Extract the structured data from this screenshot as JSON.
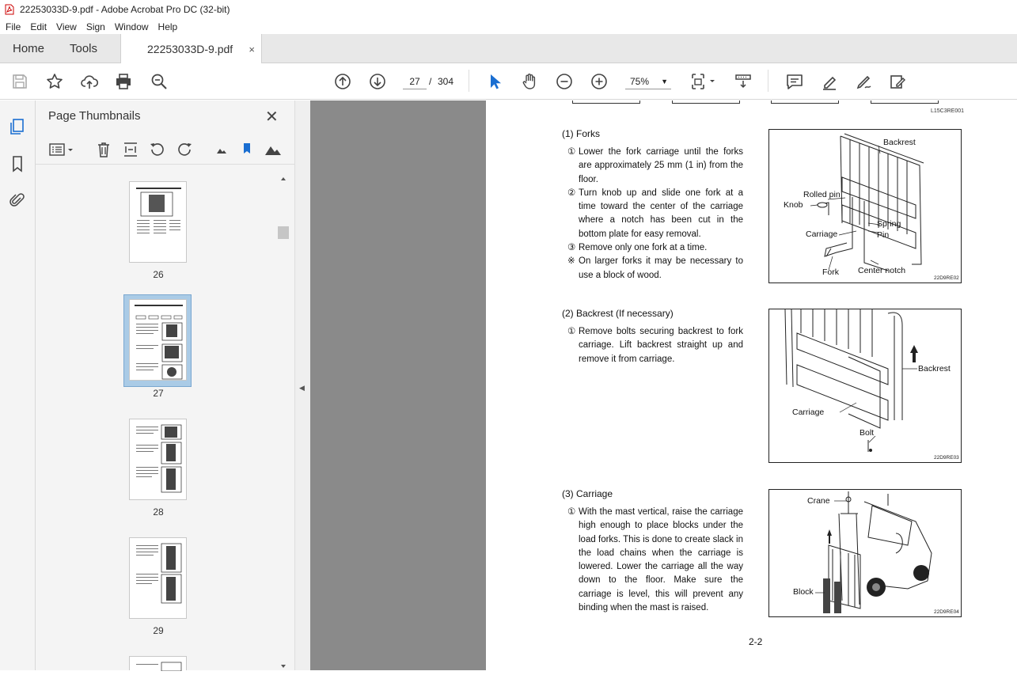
{
  "window": {
    "title": "22253033D-9.pdf - Adobe Acrobat Pro DC (32-bit)"
  },
  "menu": [
    "File",
    "Edit",
    "View",
    "Sign",
    "Window",
    "Help"
  ],
  "tabs": {
    "home": "Home",
    "tools": "Tools",
    "document": "22253033D-9.pdf",
    "close_glyph": "×"
  },
  "toolbar": {
    "current_page": "27",
    "separator": "/",
    "total_pages": "304",
    "zoom": "75%",
    "zoom_caret": "▼"
  },
  "thumbnails_panel": {
    "title": "Page Thumbnails",
    "close_glyph": "✕",
    "pages": [
      {
        "label": "26"
      },
      {
        "label": "27",
        "selected": true
      },
      {
        "label": "28"
      },
      {
        "label": "29"
      }
    ]
  },
  "splitter_glyph": "◀",
  "page": {
    "header_code": "L15C3RE001",
    "sections": [
      {
        "title": "(1) Forks",
        "items": [
          {
            "marker": "①",
            "text": "Lower the fork carriage until the forks are approximately 25 mm (1 in) from the floor."
          },
          {
            "marker": "②",
            "text": "Turn knob up and slide one fork at a time toward the center of the carriage where a notch has been cut in the bottom plate for easy removal."
          },
          {
            "marker": "③",
            "text": "Remove only one fork at a time."
          },
          {
            "marker": "※",
            "text": "On larger forks it may be necessary to use a block of wood."
          }
        ],
        "figure": {
          "labels": {
            "backrest": "Backrest",
            "rolled_pin": "Rolled pin",
            "knob": "Knob",
            "spring": "Spring",
            "pin": "Pin",
            "carriage": "Carriage",
            "fork": "Fork",
            "center_notch": "Center notch"
          },
          "code": "22D9RE02"
        }
      },
      {
        "title": "(2) Backrest (If necessary)",
        "items": [
          {
            "marker": "①",
            "text": "Remove bolts securing backrest to fork carriage. Lift backrest straight up and remove it from carriage."
          }
        ],
        "figure": {
          "labels": {
            "backrest": "Backrest",
            "carriage": "Carriage",
            "bolt": "Bolt"
          },
          "code": "22D9RE03"
        }
      },
      {
        "title": "(3) Carriage",
        "items": [
          {
            "marker": "①",
            "text": "With the mast vertical, raise the carriage high enough to place blocks under the load forks.  This is done to create slack in the load chains when the carriage is lowered.  Lower the carriage all the way down to the floor.  Make sure the carriage is level, this will prevent any binding when the mast is raised."
          }
        ],
        "figure": {
          "labels": {
            "crane": "Crane",
            "block": "Block"
          },
          "code": "22D9RE04"
        }
      }
    ],
    "page_number": "2-2"
  }
}
